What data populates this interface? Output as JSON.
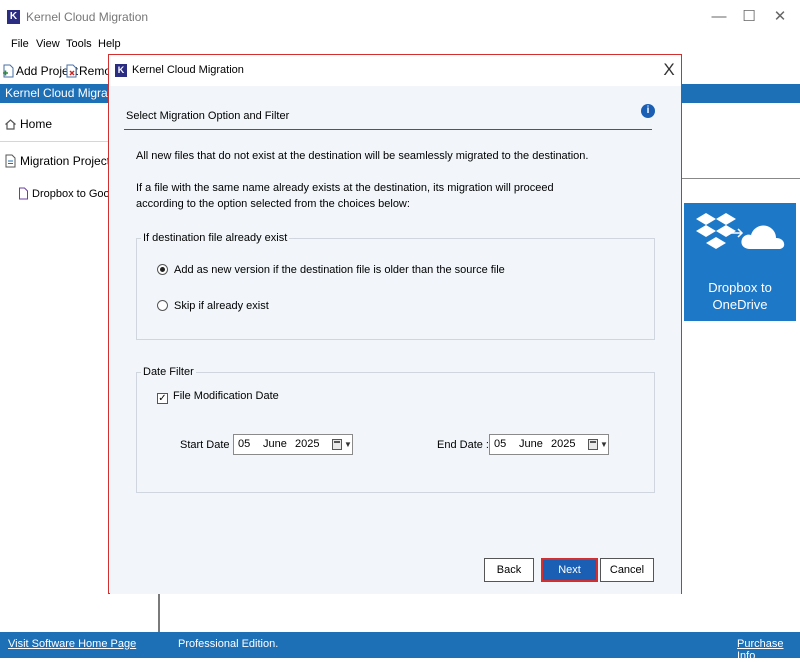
{
  "app": {
    "title": "Kernel Cloud Migration",
    "logo_letter": "K",
    "controls": {
      "minimize": "—",
      "maximize": "☐",
      "close": "✕"
    }
  },
  "menu": [
    "File",
    "View",
    "Tools",
    "Help"
  ],
  "toolbar": {
    "add_project": "Add Project",
    "remove": "Remov"
  },
  "ribbon_title": "Kernel Cloud Migration",
  "sidebar": {
    "home": "Home",
    "projects": "Migration Projects",
    "project_item": "Dropbox to Google Dr"
  },
  "tile": {
    "label_line1": "Dropbox to",
    "label_line2": "OneDrive"
  },
  "statusbar": {
    "home_link": "Visit Software Home Page",
    "edition": "Professional Edition.",
    "purchase_link": "Purchase Info"
  },
  "dialog": {
    "title": "Kernel Cloud Migration",
    "close": "X",
    "heading": "Select Migration Option and Filter",
    "info": "i",
    "para1": "All new files that do not exist at the destination will be seamlessly migrated to the destination.",
    "para2_line1": "If a file with the same name already exists at the destination, its migration will proceed",
    "para2_line2": "according to the option selected from the choices below:",
    "exist_group": {
      "legend": "If destination file already exist",
      "options": [
        {
          "label": "Add as new version if the destination file is older than the source file",
          "selected": true
        },
        {
          "label": "Skip if already exist",
          "selected": false
        }
      ]
    },
    "date_filter": {
      "legend": "Date Filter",
      "checkbox_label": "File Modification Date",
      "checkbox_checked": true,
      "check_mark": "✓",
      "start_label": "Start Date :",
      "start": {
        "day": "05",
        "month": "June",
        "year": "2025"
      },
      "end_label": "End Date :",
      "end": {
        "day": "05",
        "month": "June",
        "year": "2025"
      },
      "dropdown_arrow": "▼"
    },
    "buttons": {
      "back": "Back",
      "next": "Next",
      "cancel": "Cancel"
    }
  },
  "colors": {
    "accent_blue": "#1d6fb6",
    "tile_blue": "#1e78c8",
    "highlight_red": "#d32f2f",
    "logo_navy": "#2b2d82"
  }
}
